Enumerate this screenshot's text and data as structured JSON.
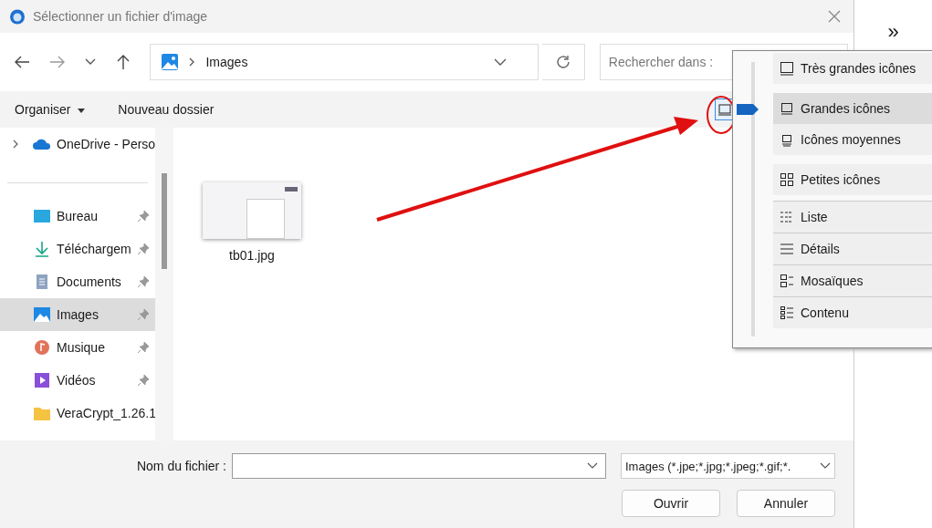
{
  "window": {
    "title": "Sélectionner un fichier d'image"
  },
  "background": {
    "overflow": "»"
  },
  "address": {
    "location": "Images"
  },
  "search": {
    "placeholder": "Rechercher dans :"
  },
  "toolbar": {
    "organize": "Organiser",
    "new_folder": "Nouveau dossier"
  },
  "sidebar": {
    "items": [
      {
        "label": "OneDrive - Perso",
        "kind": "cloud",
        "expandable": true,
        "pinned": false,
        "selected": false
      },
      {
        "label": "Bureau",
        "kind": "desktop",
        "expandable": false,
        "pinned": true,
        "selected": false
      },
      {
        "label": "Téléchargem",
        "kind": "download",
        "expandable": false,
        "pinned": true,
        "selected": false
      },
      {
        "label": "Documents",
        "kind": "documents",
        "expandable": false,
        "pinned": true,
        "selected": false
      },
      {
        "label": "Images",
        "kind": "pictures",
        "expandable": false,
        "pinned": true,
        "selected": true
      },
      {
        "label": "Musique",
        "kind": "music",
        "expandable": false,
        "pinned": true,
        "selected": false
      },
      {
        "label": "Vidéos",
        "kind": "videos",
        "expandable": false,
        "pinned": true,
        "selected": false
      },
      {
        "label": "VeraCrypt_1.26.1",
        "kind": "folder",
        "expandable": false,
        "pinned": false,
        "selected": false
      }
    ]
  },
  "files": [
    {
      "name": "tb01.jpg"
    }
  ],
  "view_menu": {
    "groups": [
      [
        {
          "label": "Très grandes icônes",
          "kind": "xl",
          "selected": false
        }
      ],
      [
        {
          "label": "Grandes icônes",
          "kind": "large",
          "selected": true
        },
        {
          "label": "Icônes moyennes",
          "kind": "medium",
          "selected": false
        }
      ],
      [
        {
          "label": "Petites icônes",
          "kind": "small",
          "selected": false
        }
      ],
      [
        {
          "label": "Liste",
          "kind": "list",
          "selected": false
        }
      ],
      [
        {
          "label": "Détails",
          "kind": "details",
          "selected": false
        }
      ],
      [
        {
          "label": "Mosaïques",
          "kind": "tiles",
          "selected": false
        }
      ],
      [
        {
          "label": "Contenu",
          "kind": "content",
          "selected": false
        }
      ]
    ]
  },
  "footer": {
    "filename_label": "Nom du fichier :",
    "filter": "Images (*.jpe;*.jpg;*.jpeg;*.gif;*.",
    "open": "Ouvrir",
    "cancel": "Annuler"
  }
}
